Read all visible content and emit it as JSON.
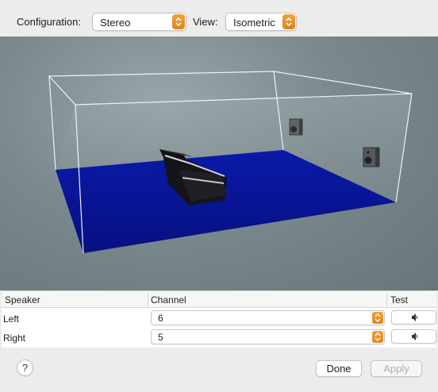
{
  "toolbar": {
    "configuration_label": "Configuration:",
    "configuration_value": "Stereo",
    "view_label": "View:",
    "view_value": "Isometric"
  },
  "colors": {
    "accent": "#e8902a",
    "floor": "#0a1a9e",
    "walls": "#7a888d"
  },
  "table": {
    "headers": [
      "Speaker",
      "Channel",
      "Test"
    ],
    "rows": [
      {
        "speaker": "Left",
        "channel": "6",
        "test_icon": "speaker-icon"
      },
      {
        "speaker": "Right",
        "channel": "5",
        "test_icon": "speaker-icon"
      }
    ]
  },
  "footer": {
    "help_label": "?",
    "done_label": "Done",
    "apply_label": "Apply"
  }
}
